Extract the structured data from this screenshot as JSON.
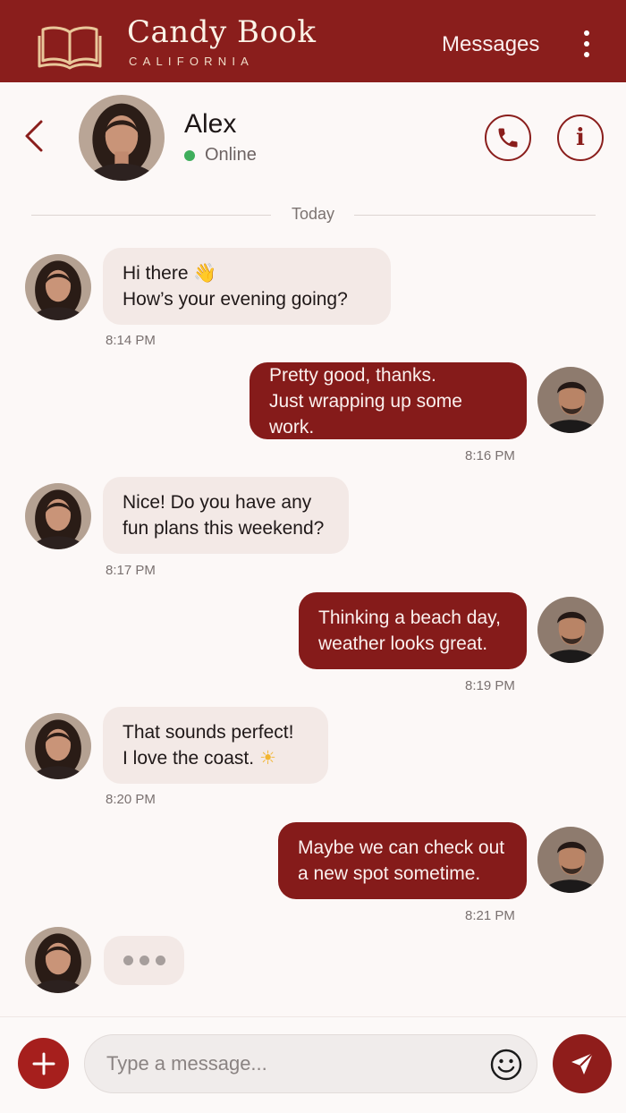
{
  "colors": {
    "brand": "#8a1e1c",
    "online": "#3fae5c",
    "incoming_bubble": "#f3e9e6",
    "outgoing_bubble": "#851b1a"
  },
  "app": {
    "name": "Candy Book",
    "subtitle": "CALIFORNIA",
    "nav_messages": "Messages"
  },
  "contact": {
    "name": "Alex",
    "status": "Online"
  },
  "divider": {
    "label": "Today"
  },
  "messages": [
    {
      "direction": "in",
      "line1": "Hi there",
      "emoji": "👋",
      "line2": "How’s your evening going?",
      "time": "8:14 PM"
    },
    {
      "direction": "out",
      "line1": "Pretty good, thanks.",
      "line2": "Just wrapping up some work.",
      "time": "8:16 PM"
    },
    {
      "direction": "in",
      "line1": "Nice! Do you have any",
      "line2": "fun plans this weekend?",
      "time": "8:17 PM"
    },
    {
      "direction": "out",
      "line1": "Thinking a beach day,",
      "line2": "weather looks great.",
      "time": "8:19 PM"
    },
    {
      "direction": "in",
      "line1": "That sounds perfect!",
      "line2": "I love the coast.",
      "emoji": "☀",
      "time": "8:20 PM"
    },
    {
      "direction": "out",
      "line1": "Maybe we can check out",
      "line2": "a new spot sometime.",
      "time": "8:21 PM"
    }
  ],
  "composer": {
    "placeholder": "Type a message..."
  },
  "icons": {
    "logo": "open-book-icon",
    "menu": "vertical-dots-icon",
    "back": "chevron-left-icon",
    "call": "phone-icon",
    "info": "info-icon",
    "add": "plus-icon",
    "emoji": "smiley-icon",
    "send": "paper-plane-icon"
  }
}
